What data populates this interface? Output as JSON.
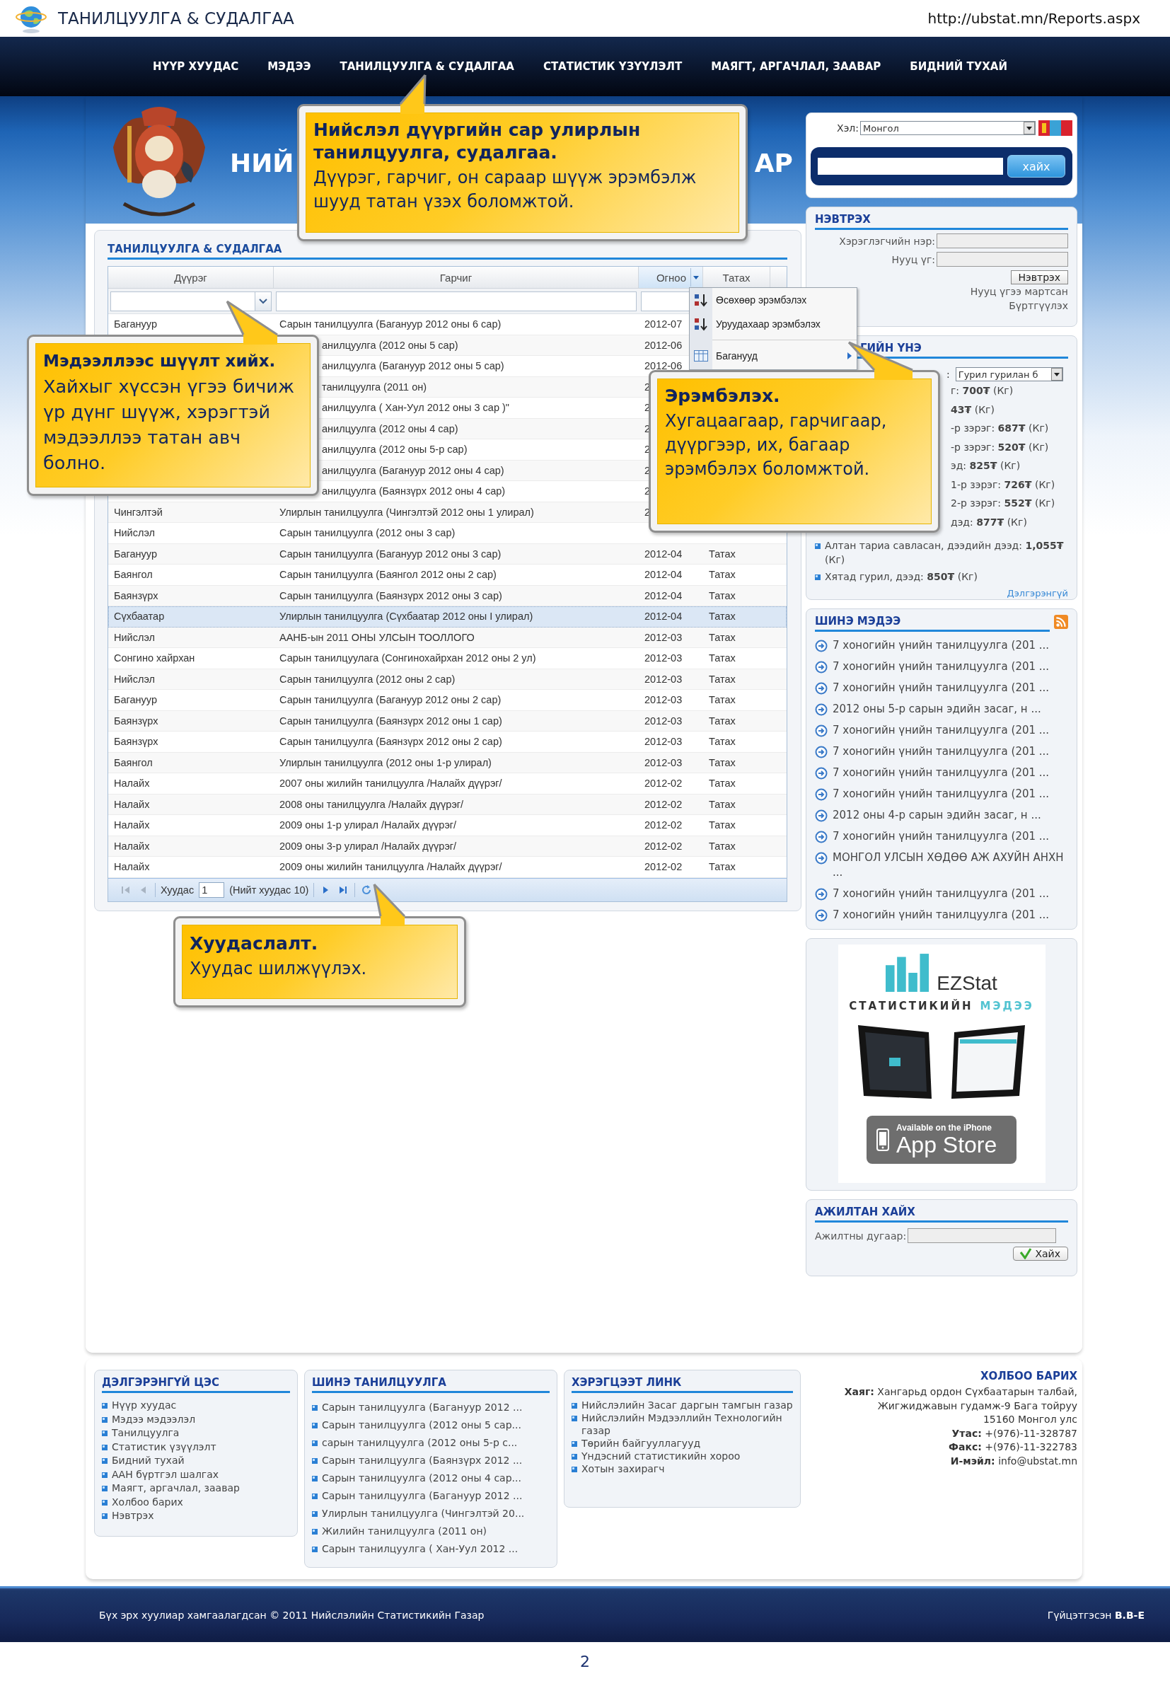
{
  "browser": {
    "title": "ТАНИЛЦУУЛГА & СУДАЛГАА",
    "url": "http://ubstat.mn/Reports.aspx"
  },
  "nav": [
    "НҮҮР ХУУДАС",
    "МЭДЭЭ",
    "ТАНИЛЦУУЛГА & СУДАЛГАА",
    "СТАТИСТИК ҮЗҮҮЛЭЛТ",
    "МАЯГТ, АРГАЧЛАЛ, ЗААВАР",
    "БИДНИЙ ТУХАЙ"
  ],
  "banner": {
    "title_left": "НИЙ",
    "title_right": "АР"
  },
  "reports": {
    "title": "ТАНИЛЦУУЛГА & СУДАЛГАА",
    "columns": [
      {
        "label": "Дүүрэг",
        "menu_open": false
      },
      {
        "label": "Гарчиг",
        "menu_open": false
      },
      {
        "label": "Огноо",
        "menu_open": true
      },
      {
        "label": "Татах",
        "menu_open": false
      }
    ],
    "sort_menu": [
      {
        "label": "Өсөхөөр эрэмбэлэх",
        "kind": "asc"
      },
      {
        "label": "Уруудахаар эрэмбэлэх",
        "kind": "desc"
      },
      {
        "label": "Баганууд",
        "kind": "columns"
      }
    ],
    "rows": [
      {
        "district": "Багануур",
        "title": "Сарын танилцуулга (Багануур 2012 оны 6 сар)",
        "date": "2012-07",
        "selected": false
      },
      {
        "title": "анилцуулга (2012 оны 5 сар)",
        "date": "2012-06",
        "selected": false
      },
      {
        "title": "анилцуулга (Багануур 2012 оны 5 сар)",
        "date": "2012-06",
        "selected": false
      },
      {
        "title": "танилцуулга (2011 он)",
        "date": "2",
        "selected": false
      },
      {
        "title": "анилцуулга ( Хан-Уул 2012 оны 3 сар )\"",
        "date": "2",
        "selected": false
      },
      {
        "title": "анилцуулга (2012 оны 4 сар)",
        "date": "2",
        "selected": false
      },
      {
        "title": "анилцуулга (2012 оны 5-р сар)",
        "date": "2",
        "selected": false
      },
      {
        "title": "анилцуулга (Багануур 2012 оны 4 сар)",
        "date": "2",
        "selected": false
      },
      {
        "title": "анилцуулга (Баянзүрх 2012 оны 4 сар)",
        "date": "2",
        "selected": false
      },
      {
        "district": "Чингэлтэй",
        "title": "Улирлын танилцуулга (Чингэлтэй 2012 оны 1 улирал)",
        "date": "2",
        "selected": false
      },
      {
        "district": "Нийслэл",
        "title": "Сарын танилцуулга (2012 оны 3 сар)",
        "selected": false
      },
      {
        "district": "Багануур",
        "title": "Сарын танилцуулга (Багануур 2012 оны 3 сар)",
        "date": "2012-04",
        "download": "Татах",
        "selected": false
      },
      {
        "district": "Баянгол",
        "title": "Сарын танилцуулга (Баянгол 2012 оны 2 сар)",
        "date": "2012-04",
        "download": "Татах",
        "selected": false
      },
      {
        "district": "Баянзүрх",
        "title": "Сарын танилцуулга (Баянзүрх 2012 оны 3 сар)",
        "date": "2012-04",
        "download": "Татах",
        "selected": false
      },
      {
        "district": "Сүхбаатар",
        "title": "Улирлын танилцуулга (Сүхбаатар 2012 оны I улирал)",
        "date": "2012-04",
        "download": "Татах",
        "selected": true
      },
      {
        "district": "Нийслэл",
        "title": "ААНБ-ын 2011 ОНЫ УЛСЫН ТООЛЛОГО",
        "date": "2012-03",
        "download": "Татах",
        "selected": false
      },
      {
        "district": "Сонгино хайрхан",
        "title": "Сарын танилцуулага (Сонгинохайрхан 2012 оны 2 ул)",
        "date": "2012-03",
        "download": "Татах",
        "selected": false
      },
      {
        "district": "Нийслэл",
        "title": "Сарын танилцуулга (2012 оны 2 сар)",
        "date": "2012-03",
        "download": "Татах",
        "selected": false
      },
      {
        "district": "Багануур",
        "title": "Сарын танилцуулга (Багануур 2012 оны 2 сар)",
        "date": "2012-03",
        "download": "Татах",
        "selected": false
      },
      {
        "district": "Баянзүрх",
        "title": "Сарын танилцуулга (Баянзүрх 2012 оны 1 сар)",
        "date": "2012-03",
        "download": "Татах",
        "selected": false
      },
      {
        "district": "Баянзүрх",
        "title": "Сарын танилцуулга (Баянзүрх 2012 оны 2 сар)",
        "date": "2012-03",
        "download": "Татах",
        "selected": false
      },
      {
        "district": "Баянгол",
        "title": "Улирлын танилцуулга (2012 оны 1-р улирал)",
        "date": "2012-03",
        "download": "Татах",
        "selected": false
      },
      {
        "district": "Налайх",
        "title": "2007 оны жилийн танилцуулга /Налайх дүүрэг/",
        "date": "2012-02",
        "download": "Татах",
        "selected": false
      },
      {
        "district": "Налайх",
        "title": "2008 оны танилцуулга /Налайх дүүрэг/",
        "date": "2012-02",
        "download": "Татах",
        "selected": false
      },
      {
        "district": "Налайх",
        "title": "2009 оны 1-р улирал /Налайх дүүрэг/",
        "date": "2012-02",
        "download": "Татах",
        "selected": false
      },
      {
        "district": "Налайх",
        "title": "2009 оны 3-р улирал /Налайх дүүрэг/",
        "date": "2012-02",
        "download": "Татах",
        "selected": false
      },
      {
        "district": "Налайх",
        "title": "2009 оны жилийн танилцуулга /Налайх дүүрэг/",
        "date": "2012-02",
        "download": "Татах",
        "selected": false
      }
    ],
    "pager": {
      "label": "Хуудас",
      "page": "1",
      "total": "(Нийт хуудас 10)"
    }
  },
  "sidebar": {
    "language": {
      "label": "Хэл:",
      "value": "Монгол"
    },
    "search": {
      "button": "хайх"
    },
    "login": {
      "title": "НЭВТРЭХ",
      "user_label": "Хэрэглэгчийн нэр:",
      "pass_label": "Нууц үг:",
      "button": "Нэвтрэх",
      "links": [
        "Нууц үгээ мартсан",
        "Бүртгүүлэх"
      ]
    },
    "prices": {
      "title": "ГИЙН ҮНЭ",
      "select_label": ":",
      "select_value": "Гурил гурилан б",
      "items": [
        {
          "kind": "covered",
          "text": "г: **700₮** (Кг)"
        },
        {
          "kind": "covered",
          "text": "**43₮** (Кг)"
        },
        {
          "kind": "covered",
          "text": "-р зэрэг: **687₮** (Кг)"
        },
        {
          "kind": "covered",
          "text": "-р зэрэг: **520₮** (Кг)"
        },
        {
          "kind": "covered",
          "text": "эд: **825₮** (Кг)"
        },
        {
          "kind": "covered",
          "text": "1-р зэрэг: **726₮** (Кг)"
        },
        {
          "kind": "covered",
          "text": "2-р зэрэг: **552₮** (Кг)"
        },
        {
          "kind": "covered",
          "text": "дэд: **877₮** (Кг)"
        },
        {
          "kind": "bullet",
          "text": "Алтан тариа савласан, дээдийн дээд: **1,055₮** (Кг)"
        },
        {
          "kind": "bullet",
          "text": "Хятад гурил, дээд: **850₮** (Кг)"
        }
      ],
      "more": "Дэлгэрэнгүй"
    },
    "news": {
      "title": "ШИНЭ МЭДЭЭ",
      "items": [
        "7 хоногийн үнийн танилцуулга (201 ...",
        "7 хоногийн үнийн танилцуулга (201 ...",
        "7 хоногийн үнийн танилцуулга (201 ...",
        "2012 оны 5-р сарын эдийн засаг, н ...",
        "7 хоногийн үнийн танилцуулга (201 ...",
        "7 хоногийн үнийн танилцуулга (201 ...",
        "7 хоногийн үнийн танилцуулга (201 ...",
        "7 хоногийн үнийн танилцуулга (201 ...",
        "2012 оны 4-р сарын эдийн засаг, н ...",
        "7 хоногийн үнийн танилцуулга (201 ...",
        "МОНГОЛ УЛСЫН ХӨДӨӨ АЖ АХУЙН АНХН ...",
        "7 хоногийн үнийн танилцуулга (201 ...",
        "7 хоногийн үнийн танилцуулга (201 ..."
      ]
    },
    "app_ad": {
      "brand": "EZStat",
      "tagline_dark": "СТАТИСТИКИЙН",
      "tagline_light": "МЭДЭЭ",
      "badge_small": "Available on the iPhone",
      "badge_large": "App Store"
    },
    "staff": {
      "title": "АЖИЛТАН ХАЙХ",
      "label": "Ажилтны дугаар:",
      "button": "Хайх"
    }
  },
  "footer": {
    "menus": [
      {
        "title": "ДЭЛГЭРЭНГҮЙ ЦЭС",
        "items": [
          "Нүүр хуудас",
          "Мэдээ мэдээлэл",
          "Танилцуулга",
          "Статистик үзүүлэлт",
          "Бидний тухай",
          "ААН бүртгэл шалгах",
          "Маягт, аргачлал, заавар",
          "Холбоо барих",
          "Нэвтрэх"
        ]
      },
      {
        "title": "ШИНЭ ТАНИЛЦУУЛГА",
        "items": [
          "Сарын танилцуулга (Багануур 2012 ...",
          "Сарын танилцуулга (2012 оны 5 сар...",
          "сарын танилцуулга (2012 оны 5-р с...",
          "Сарын танилцуулга (Баянзүрх 2012 ...",
          "Сарын танилцуулга (2012 оны 4 сар...",
          "Сарын танилцуулга (Багануур 2012 ...",
          "Улирлын танилцуулга (Чингэлтэй 20...",
          "Жилийн танилцуулга (2011 он)",
          "Сарын танилцуулга ( Хан-Уул 2012 ..."
        ]
      },
      {
        "title": "ХЭРЭГЦЭЭТ ЛИНК",
        "items": [
          "Нийслэлийн Засаг даргын тамгын газар",
          "Нийслэлийн Мэдээллийн Технологийн газар",
          "Төрийн байгууллагууд",
          "Үндэсний статистикийн хороо",
          "Хотын захирагч"
        ]
      }
    ],
    "contact": {
      "title": "ХОЛБОО БАРИХ",
      "lines": [
        "**Хаяг:** Хангарьд ордон Сүхбаатарын талбай,",
        "Жигжиджавын гудамж-9 Бага тойруу",
        "15160 Монгол улс",
        "**Утас:** +(976)-11-328787",
        "**Факс:** +(976)-11-322783",
        "**И-мэйл:** info@ubstat.mn"
      ]
    }
  },
  "bottom": {
    "copyright": "Бүх эрх хуулиар хамгаалагдсан © 2011 Нийслэлийн Статистикийн Газар",
    "credit": "Гүйцэтгэсэн **B.B-E**"
  },
  "page_number": "2",
  "callouts": [
    {
      "heading": "Нийслэл дүүргийн сар улирлын танилцуулга, судалгаа.",
      "body": "Дүүрэг, гарчиг, он сараар шүүж эрэмбэлж шууд татан үзэх боломжтой."
    },
    {
      "heading": "Мэдээллээс шүүлт хийх.",
      "body": "Хайхыг хүссэн үгээ бичиж үр дүнг шүүж, хэрэгтэй мэдээллээ татан авч болно."
    },
    {
      "heading": "Эрэмбэлэх.",
      "body": "Хугацаагаар, гарчигаар, дүүргээр, их, багаар эрэмбэлэх боломжтой."
    },
    {
      "heading": "Хуудаслалт.",
      "body": "Хуудас шилжүүлэх."
    }
  ]
}
